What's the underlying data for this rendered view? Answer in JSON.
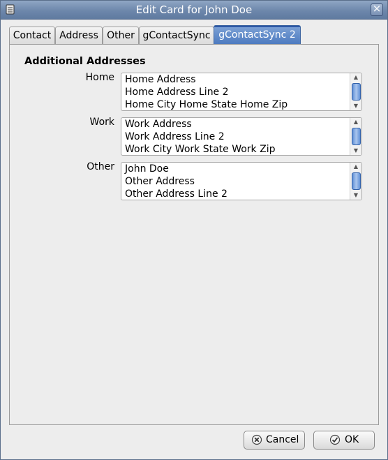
{
  "window": {
    "title": "Edit Card for John Doe"
  },
  "tabs": [
    {
      "label": "Contact",
      "active": false
    },
    {
      "label": "Address",
      "active": false
    },
    {
      "label": "Other",
      "active": false
    },
    {
      "label": "gContactSync",
      "active": false
    },
    {
      "label": "gContactSync 2",
      "active": true
    }
  ],
  "section": {
    "title": "Additional Addresses"
  },
  "addresses": [
    {
      "label": "Home",
      "lines": [
        "Home Address",
        "Home Address Line 2",
        "Home City Home State  Home Zip"
      ]
    },
    {
      "label": "Work",
      "lines": [
        "Work Address",
        "Work Address Line 2",
        "Work City Work State  Work Zip"
      ]
    },
    {
      "label": "Other",
      "lines": [
        "John Doe",
        "Other Address",
        "Other Address Line 2"
      ]
    }
  ],
  "buttons": {
    "cancel": "Cancel",
    "ok": "OK"
  },
  "colors": {
    "titlebar": "#6d87ab",
    "active_tab": "#4b79bf"
  },
  "icons": {
    "app": "card-icon",
    "close": "close-icon",
    "cancel": "cancel-icon",
    "ok": "ok-icon"
  }
}
